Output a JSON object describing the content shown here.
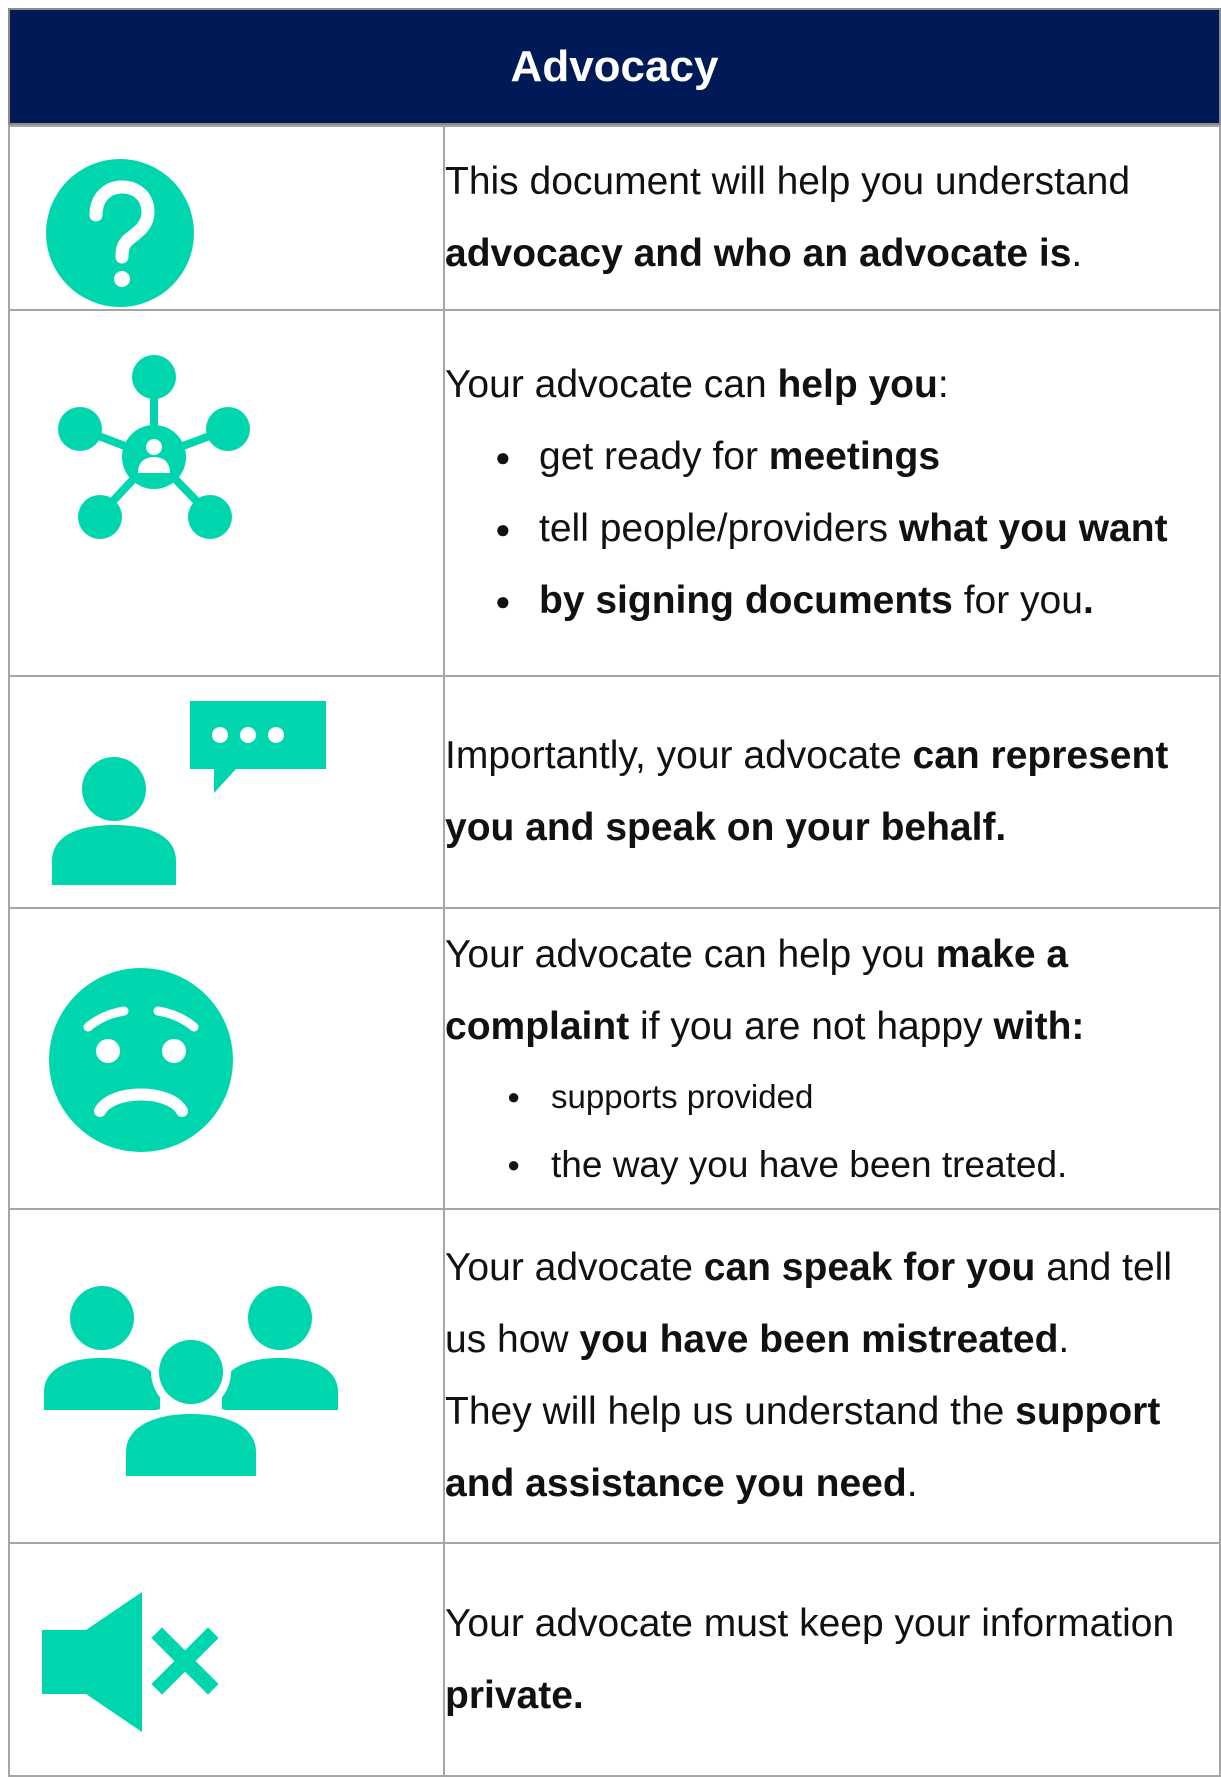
{
  "header": {
    "title": "Advocacy"
  },
  "colors": {
    "header_bg": "#001a57",
    "icon_teal": "#00d6ae",
    "grid": "#a6a6a6"
  },
  "rows": [
    {
      "icon": "question-mark-circle-icon",
      "text": {
        "p1": "This document will help you understand ",
        "p1_bold": "advocacy and who an advocate is",
        "p1_end": "."
      }
    },
    {
      "icon": "network-person-icon",
      "text": {
        "intro": "Your advocate can ",
        "intro_bold": "help you",
        "intro_end": ":",
        "bullets": [
          {
            "pre": "get ready for ",
            "bold": "meetings",
            "post": ""
          },
          {
            "pre": "tell people/providers ",
            "bold": "what you want",
            "post": ""
          },
          {
            "pre": "",
            "bold": "by signing documents",
            "post": " for you",
            "post_bold": "."
          }
        ]
      }
    },
    {
      "icon": "person-speech-bubble-icon",
      "text": {
        "p1": "Importantly, your advocate ",
        "p1_bold": "can represent you and speak on your behalf."
      }
    },
    {
      "icon": "worried-face-icon",
      "text": {
        "p1": "Your advocate can help you ",
        "p1_bold": "make a complaint",
        "p1_mid": " if you are not happy ",
        "p1_bold2": "with:",
        "bullets": [
          "supports provided",
          "the way you have been treated."
        ]
      }
    },
    {
      "icon": "group-of-people-icon",
      "text": {
        "p1": "Your advocate ",
        "p1_bold": "can speak for you",
        "p1_mid": " and tell us how ",
        "p1_bold2": "you have been mistreated",
        "p1_end": ".",
        "p2": "They will help us understand the ",
        "p2_bold": "support and assistance you need",
        "p2_end": "."
      }
    },
    {
      "icon": "muted-speaker-icon",
      "text": {
        "p1": "Your advocate must keep your information ",
        "p1_bold": "private."
      }
    }
  ]
}
